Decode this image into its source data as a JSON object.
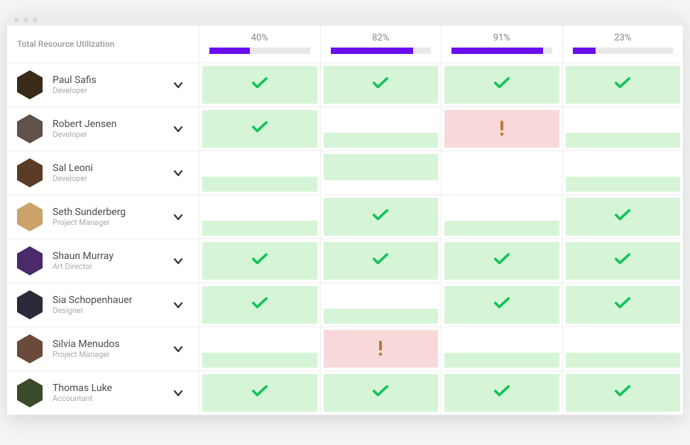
{
  "header": {
    "title": "Total Resource Utilization",
    "columns": [
      {
        "percent": "40%",
        "value": 40
      },
      {
        "percent": "82%",
        "value": 82
      },
      {
        "percent": "91%",
        "value": 91
      },
      {
        "percent": "23%",
        "value": 23
      }
    ]
  },
  "colors": {
    "accent": "#6a0ef0",
    "ok_bg": "#d6f5d6",
    "warn_bg": "#f8d9d9",
    "check": "#14c35a",
    "warn": "#b87838"
  },
  "rows": [
    {
      "name": "Paul Safis",
      "role": "Developer",
      "avatar_bg": "#3a2a18",
      "cells": [
        {
          "bg": "green",
          "icon": "check"
        },
        {
          "bg": "green",
          "icon": "check"
        },
        {
          "bg": "green",
          "icon": "check"
        },
        {
          "bg": "green",
          "icon": "check"
        }
      ]
    },
    {
      "name": "Robert Jensen",
      "role": "Developer",
      "avatar_bg": "#5e524a",
      "cells": [
        {
          "bg": "green",
          "icon": "check"
        },
        {
          "bg": "green-bottom",
          "icon": null
        },
        {
          "bg": "red",
          "icon": "warn"
        },
        {
          "bg": "green-bottom",
          "icon": null
        }
      ]
    },
    {
      "name": "Sal Leoni",
      "role": "Developer",
      "avatar_bg": "#5a3c26",
      "cells": [
        {
          "bg": "green-bottom",
          "icon": null
        },
        {
          "bg": "green-top",
          "icon": null
        },
        {
          "bg": "none",
          "icon": null
        },
        {
          "bg": "green-bottom",
          "icon": null
        }
      ]
    },
    {
      "name": "Seth Sunderberg",
      "role": "Project Manager",
      "avatar_bg": "#caa26a",
      "cells": [
        {
          "bg": "green-bottom",
          "icon": null
        },
        {
          "bg": "green",
          "icon": "check"
        },
        {
          "bg": "green-bottom",
          "icon": null
        },
        {
          "bg": "green",
          "icon": "check"
        }
      ]
    },
    {
      "name": "Shaun Murray",
      "role": "Art Director",
      "avatar_bg": "#4a2a6a",
      "cells": [
        {
          "bg": "green",
          "icon": "check"
        },
        {
          "bg": "green",
          "icon": "check"
        },
        {
          "bg": "green",
          "icon": "check"
        },
        {
          "bg": "green",
          "icon": "check"
        }
      ]
    },
    {
      "name": "Sia Schopenhauer",
      "role": "Designer",
      "avatar_bg": "#2a2a3a",
      "cells": [
        {
          "bg": "green",
          "icon": "check"
        },
        {
          "bg": "green-bottom",
          "icon": null
        },
        {
          "bg": "green",
          "icon": "check"
        },
        {
          "bg": "green",
          "icon": "check"
        }
      ]
    },
    {
      "name": "Silvia Menudos",
      "role": "Project Manager",
      "avatar_bg": "#6a4a3a",
      "cells": [
        {
          "bg": "green-bottom",
          "icon": null
        },
        {
          "bg": "red",
          "icon": "warn"
        },
        {
          "bg": "green-bottom",
          "icon": null
        },
        {
          "bg": "green-bottom",
          "icon": null
        }
      ]
    },
    {
      "name": "Thomas Luke",
      "role": "Accountant",
      "avatar_bg": "#3a4a2a",
      "cells": [
        {
          "bg": "green",
          "icon": "check"
        },
        {
          "bg": "green",
          "icon": "check"
        },
        {
          "bg": "green",
          "icon": "check"
        },
        {
          "bg": "green",
          "icon": "check"
        }
      ]
    }
  ]
}
